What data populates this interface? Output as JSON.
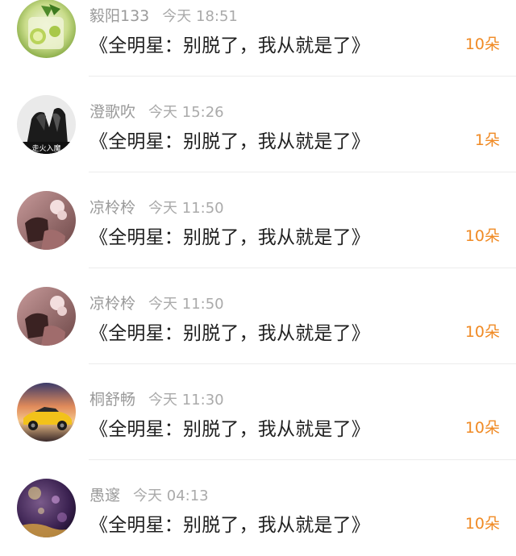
{
  "comments": [
    {
      "user": "毅阳133",
      "time": "今天 18:51",
      "text": "《全明星：别脱了，我从就是了》",
      "gift": "10朵",
      "avatar_icon": "lime-drink-avatar"
    },
    {
      "user": "澄歌吹",
      "time": "今天 15:26",
      "text": "《全明星：别脱了，我从就是了》",
      "gift": "1朵",
      "avatar_icon": "bw-hands-avatar",
      "avatar_caption": "走火入魔"
    },
    {
      "user": "凉柃柃",
      "time": "今天 11:50",
      "text": "《全明星：别脱了，我从就是了》",
      "gift": "10朵",
      "avatar_icon": "pink-portrait-avatar"
    },
    {
      "user": "凉柃柃",
      "time": "今天 11:50",
      "text": "《全明星：别脱了，我从就是了》",
      "gift": "10朵",
      "avatar_icon": "pink-portrait-avatar"
    },
    {
      "user": "桐舒畅",
      "time": "今天 11:30",
      "text": "《全明星：别脱了，我从就是了》",
      "gift": "10朵",
      "avatar_icon": "yellow-car-avatar"
    },
    {
      "user": "愚邃",
      "time": "今天 04:13",
      "text": "《全明星：别脱了，我从就是了》",
      "gift": "10朵",
      "avatar_icon": "purple-lights-avatar"
    }
  ],
  "colors": {
    "gift": "#f08a24",
    "name": "#9a9a9a",
    "text": "#1f1f1f"
  }
}
